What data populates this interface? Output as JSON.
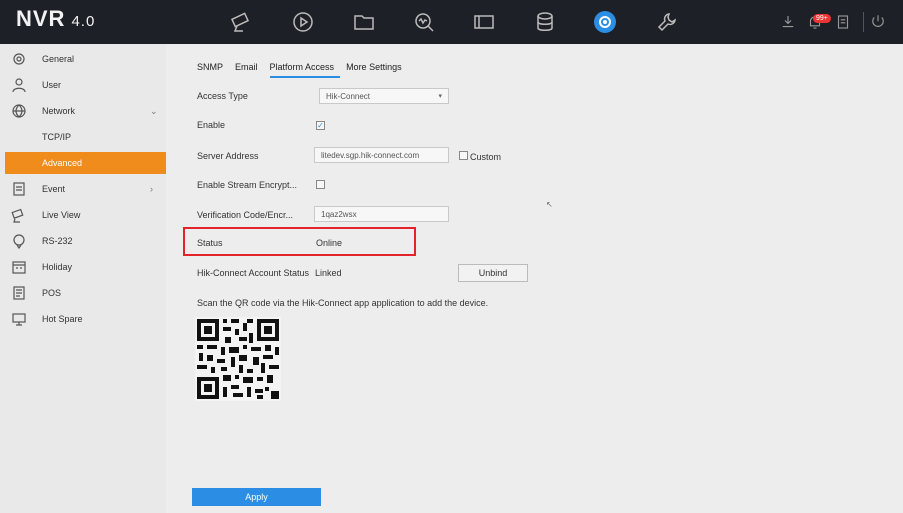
{
  "app": {
    "brand": "NVR",
    "version": "4.0"
  },
  "topbar": {
    "icons": [
      "camera-icon",
      "playback-icon",
      "file-icon",
      "analytics-icon",
      "screen-icon",
      "storage-icon",
      "settings-icon",
      "maintenance-icon"
    ],
    "active_icon": "settings-icon",
    "alarm_badge": "99+",
    "accent_color": "#2b8de3"
  },
  "sidebar": {
    "items": [
      {
        "label": "General",
        "icon": "gear-icon"
      },
      {
        "label": "User",
        "icon": "user-icon"
      },
      {
        "label": "Network",
        "icon": "globe-icon"
      },
      {
        "label": "TCP/IP",
        "icon": ""
      },
      {
        "label": "Advanced",
        "icon": ""
      },
      {
        "label": "Event",
        "icon": "event-icon"
      },
      {
        "label": "Live View",
        "icon": "live-view-icon"
      },
      {
        "label": "RS-232",
        "icon": "rs232-icon"
      },
      {
        "label": "Holiday",
        "icon": "calendar-icon"
      },
      {
        "label": "POS",
        "icon": "pos-icon"
      },
      {
        "label": "Hot Spare",
        "icon": "hot-spare-icon"
      }
    ],
    "active_label": "Advanced",
    "active_color": "#f08c1c"
  },
  "tabs": [
    "SNMP",
    "Email",
    "Platform Access",
    "More Settings"
  ],
  "active_tab": "Platform Access",
  "form": {
    "access_type": {
      "label": "Access Type",
      "value": "Hik-Connect"
    },
    "enable": {
      "label": "Enable",
      "checked": true
    },
    "server_address": {
      "label": "Server Address",
      "value": "litedev.sgp.hik-connect.com",
      "custom_label": "Custom",
      "custom_checked": false
    },
    "stream_encryption": {
      "label": "Enable Stream Encrypt...",
      "checked": false
    },
    "verification_code": {
      "label": "Verification Code/Encr...",
      "value": "1qaz2wsx"
    },
    "status": {
      "label": "Status",
      "value": "Online"
    },
    "account_status": {
      "label": "Hik-Connect Account Status",
      "value": "Linked",
      "unbind_label": "Unbind"
    },
    "qr_hint": "Scan the QR code via the Hik-Connect app application to add the device."
  },
  "apply_label": "Apply",
  "highlight_color": "#e0242a"
}
